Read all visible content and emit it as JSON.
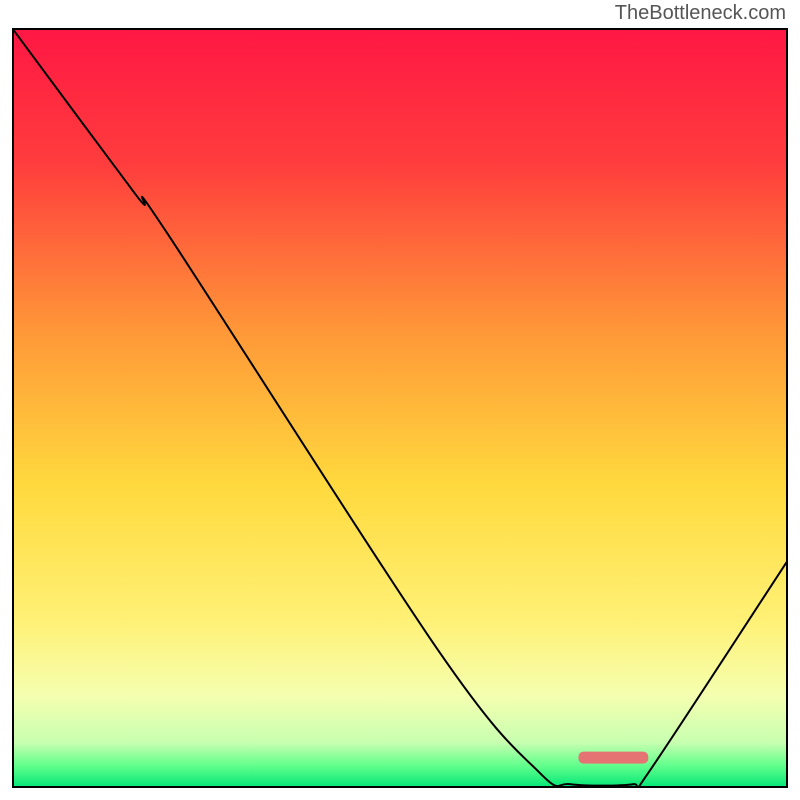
{
  "watermark": "TheBottleneck.com",
  "chart_data": {
    "type": "line",
    "title": "",
    "xlabel": "",
    "ylabel": "",
    "xlim": [
      0,
      100
    ],
    "ylim": [
      0,
      100
    ],
    "gradient_stops": [
      {
        "offset": 0,
        "color": "#ff1744"
      },
      {
        "offset": 18,
        "color": "#ff3d3d"
      },
      {
        "offset": 40,
        "color": "#ff9838"
      },
      {
        "offset": 60,
        "color": "#ffd93d"
      },
      {
        "offset": 78,
        "color": "#fff176"
      },
      {
        "offset": 88,
        "color": "#f4ffb0"
      },
      {
        "offset": 94,
        "color": "#c8ffb0"
      },
      {
        "offset": 97,
        "color": "#64ff8d"
      },
      {
        "offset": 100,
        "color": "#00e676"
      }
    ],
    "curve_points": [
      {
        "x": 0,
        "y": 100
      },
      {
        "x": 16,
        "y": 78
      },
      {
        "x": 20,
        "y": 73
      },
      {
        "x": 55,
        "y": 18
      },
      {
        "x": 68,
        "y": 2
      },
      {
        "x": 72,
        "y": 0.5
      },
      {
        "x": 80,
        "y": 0.5
      },
      {
        "x": 82,
        "y": 2
      },
      {
        "x": 100,
        "y": 30
      }
    ],
    "marker": {
      "x_start": 73,
      "x_end": 82,
      "y": 4,
      "color": "#e57373"
    }
  }
}
